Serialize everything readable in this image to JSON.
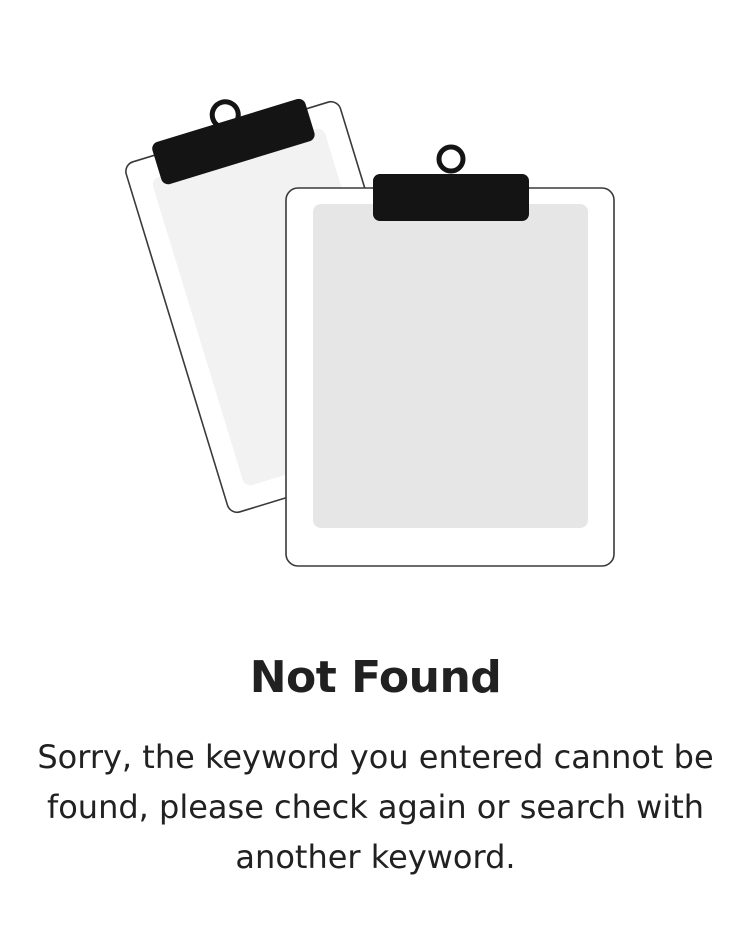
{
  "illustration": {
    "icon": "empty-clipboards-illustration",
    "colors": {
      "outline": "#3a3a3a",
      "clip": "#141414",
      "back_inner": "#f2f2f2",
      "front_inner": "#e6e6e6",
      "board": "#ffffff"
    }
  },
  "empty_state": {
    "title": "Not Found",
    "message": "Sorry, the keyword you entered cannot be found, please check again or search with another keyword."
  }
}
